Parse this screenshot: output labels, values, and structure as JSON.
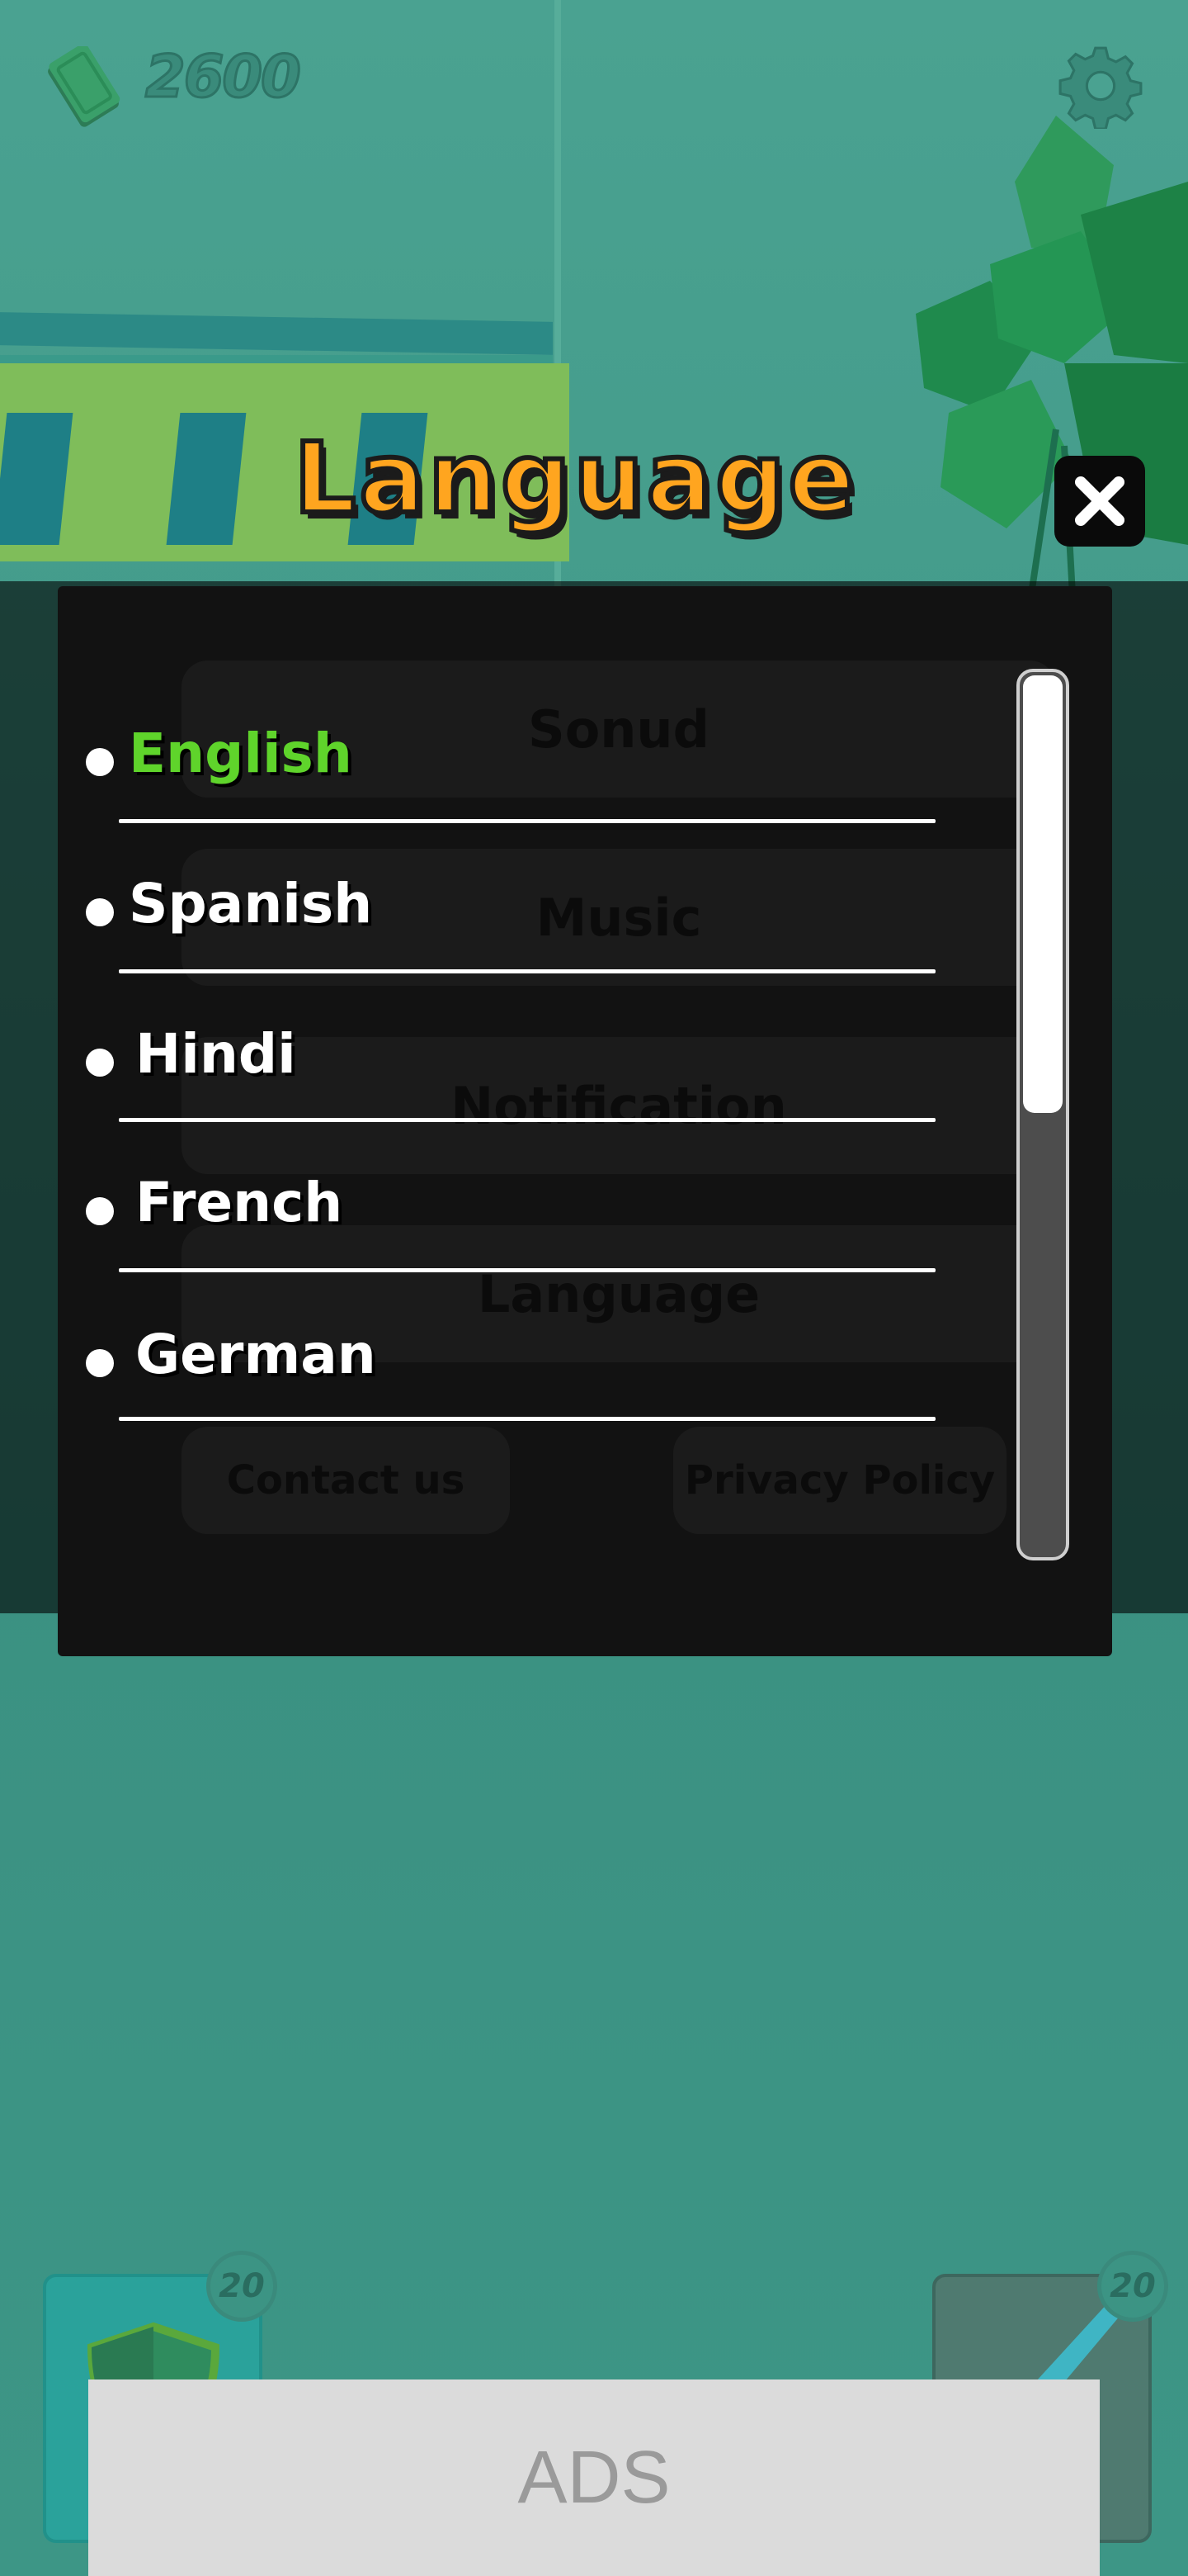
{
  "header": {
    "cash_amount": "2600",
    "cash_icon": "cash-icon",
    "settings_icon": "gear-icon"
  },
  "dialog": {
    "title": "Language",
    "close_icon": "close-icon",
    "languages": [
      {
        "label": "English",
        "selected": true
      },
      {
        "label": "Spanish",
        "selected": false
      },
      {
        "label": "Hindi",
        "selected": false
      },
      {
        "label": "French",
        "selected": false
      },
      {
        "label": "German",
        "selected": false
      }
    ],
    "selected_color": "#5fd42b"
  },
  "background_settings": {
    "items": [
      "Sonud",
      "Music",
      "Notification",
      "Language"
    ],
    "contact": "Contact us",
    "privacy": "Privacy Policy"
  },
  "bottom": {
    "left_badge": "20",
    "right_badge": "20",
    "ads_label": "ADS"
  },
  "colors": {
    "title": "#ffa51f",
    "panel": "#121212",
    "background": "#3e9686"
  }
}
